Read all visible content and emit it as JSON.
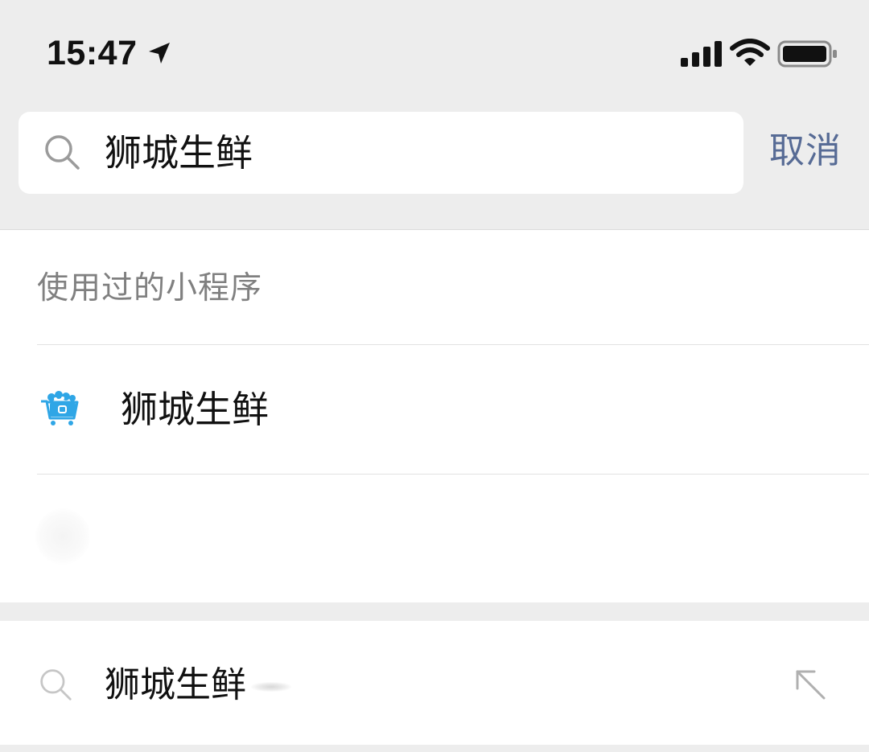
{
  "status_bar": {
    "time": "15:47",
    "icons": [
      "location-arrow-icon",
      "cellular-signal-icon",
      "wifi-icon",
      "battery-icon"
    ]
  },
  "search": {
    "query": "狮城生鲜",
    "cancel_label": "取消",
    "icon": "search-icon"
  },
  "results": {
    "section_title": "使用过的小程序",
    "items": [
      {
        "name": "狮城生鲜",
        "icon": "shopping-cart-icon"
      }
    ]
  },
  "suggestion": {
    "text": "狮城生鲜",
    "icon": "search-icon",
    "action_icon": "fill-arrow-icon"
  },
  "colors": {
    "background": "#ededed",
    "surface": "#ffffff",
    "link_blue": "#576b95",
    "secondary_text": "#808080",
    "app_icon_blue": "#2fa6e6",
    "divider": "#e2e2e2"
  }
}
